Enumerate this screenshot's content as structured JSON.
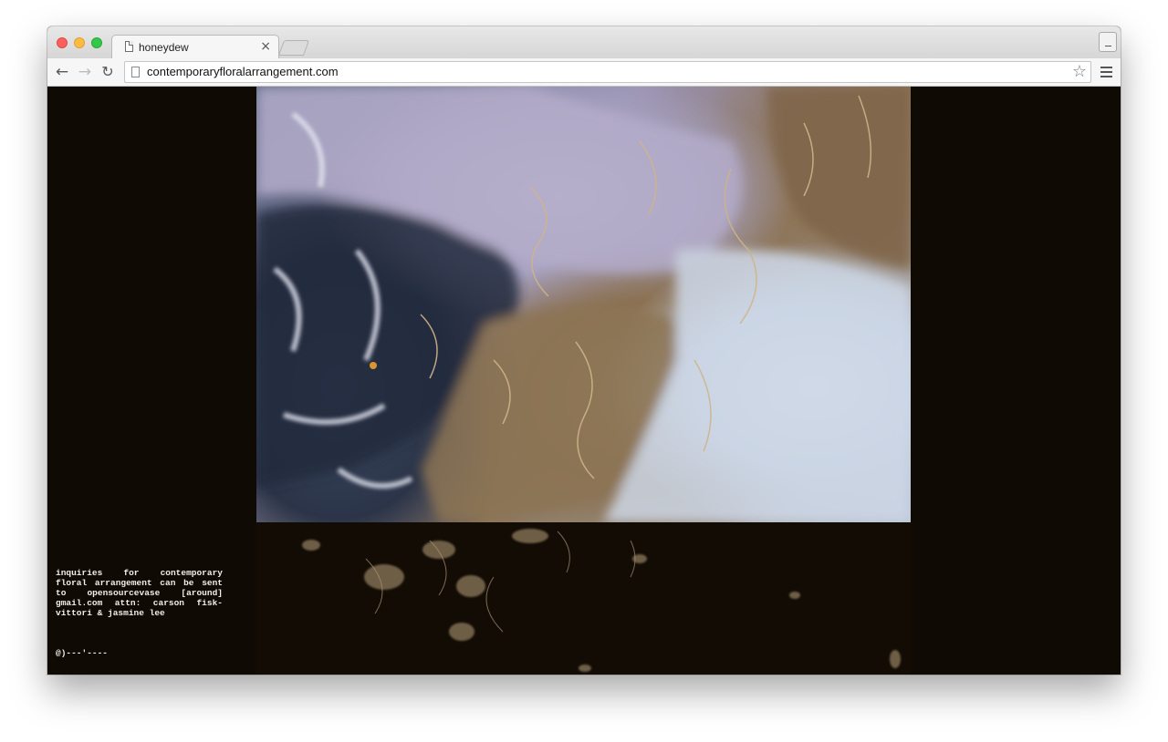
{
  "browser": {
    "tab": {
      "title": "honeydew",
      "close_glyph": "×"
    },
    "toolbar": {
      "back_glyph": "←",
      "forward_glyph": "→",
      "reload_glyph": "↻",
      "url": "contemporaryfloralarrangement.com",
      "star_glyph": "☆"
    },
    "icons": [
      "close-icon",
      "minimize-icon",
      "back-arrow-icon",
      "forward-arrow-icon",
      "reload-icon",
      "page-icon",
      "star-icon",
      "menu-icon"
    ]
  },
  "page": {
    "background": "#0f0a03",
    "inquiry_text": "inquiries for contemporary floral arrangement can be sent to opensourcevase [around] gmail.com attn: carson fisk-vittori & jasmine lee",
    "signature": "@)---'----",
    "text_color": "#f2efe8"
  }
}
